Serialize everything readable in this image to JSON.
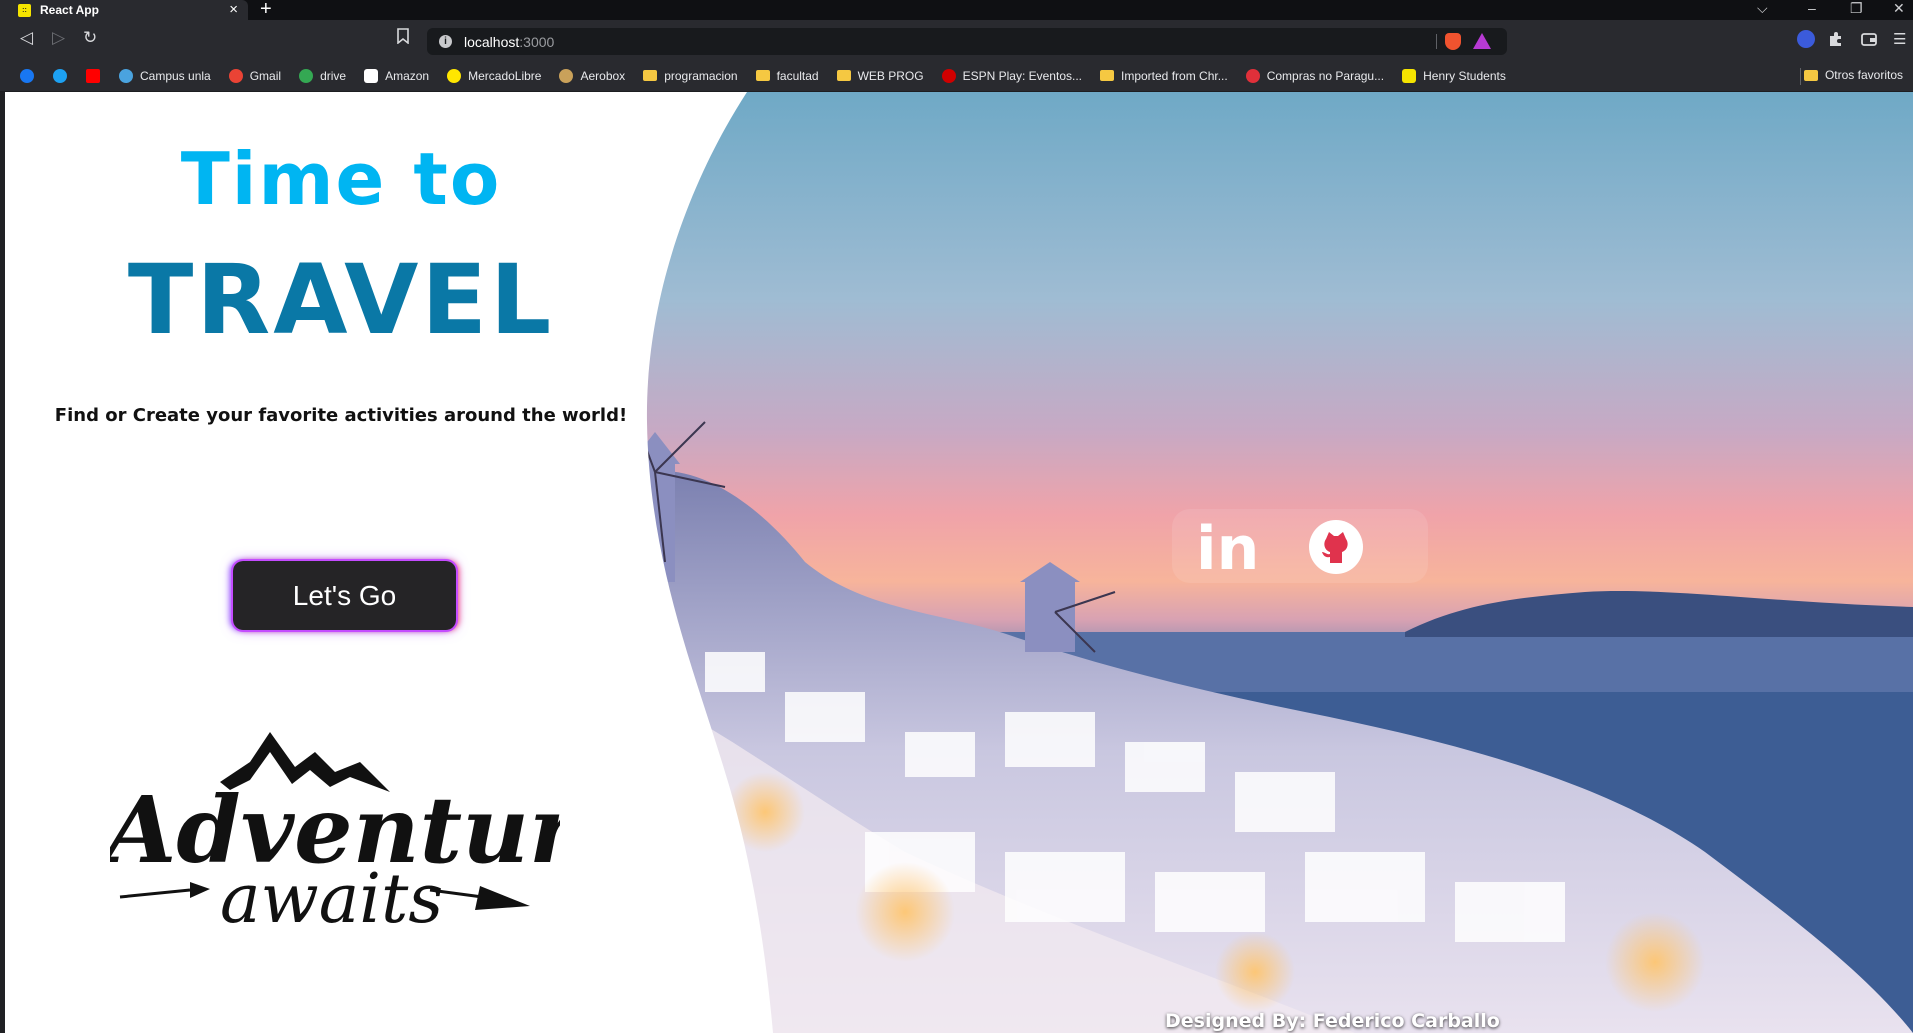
{
  "browser": {
    "tab_title": "React App",
    "tab_favicon_text": "::",
    "tab_close": "×",
    "new_tab": "+",
    "url_host": "localhost",
    "url_port": ":3000",
    "window_controls": {
      "dropdown": "⌵",
      "minimize": "–",
      "restore": "❐",
      "close": "✕"
    },
    "nav": {
      "back": "◁",
      "forward": "▷",
      "reload": "↻",
      "bookmark": "🔖︎"
    },
    "menu": "☰"
  },
  "bookmarks": [
    {
      "label": "",
      "icon": "facebook-icon",
      "color": "#1877f2"
    },
    {
      "label": "",
      "icon": "twitter-icon",
      "color": "#1da1f2"
    },
    {
      "label": "",
      "icon": "youtube-icon",
      "color": "#ff0000"
    },
    {
      "label": "Campus unla",
      "icon": "campus-icon",
      "color": "#4aa3df"
    },
    {
      "label": "Gmail",
      "icon": "gmail-icon",
      "color": "#ea4335"
    },
    {
      "label": "drive",
      "icon": "drive-icon",
      "color": "#34a853"
    },
    {
      "label": "Amazon",
      "icon": "amazon-icon",
      "color": "#ffffff"
    },
    {
      "label": "MercadoLibre",
      "icon": "mercadolibre-icon",
      "color": "#ffe600"
    },
    {
      "label": "Aerobox",
      "icon": "aerobox-icon",
      "color": "#c9a15a"
    },
    {
      "label": "programacion",
      "icon": "folder-icon",
      "color": "#f5c842"
    },
    {
      "label": "facultad",
      "icon": "folder-icon",
      "color": "#f5c842"
    },
    {
      "label": "WEB PROG",
      "icon": "folder-icon",
      "color": "#f5c842"
    },
    {
      "label": "ESPN Play: Eventos...",
      "icon": "espn-icon",
      "color": "#d00000"
    },
    {
      "label": "Imported from Chr...",
      "icon": "folder-icon",
      "color": "#f5c842"
    },
    {
      "label": "Compras no Paragu...",
      "icon": "compras-icon",
      "color": "#e0303a"
    },
    {
      "label": "Henry Students",
      "icon": "henry-icon",
      "color": "#f5e400"
    }
  ],
  "bookmarks_other": "Otros favoritos",
  "landing": {
    "title_line1": "Time to",
    "title_line2": "TRAVEL",
    "subtitle": "Find or Create your favorite activities around the world!",
    "cta_label": "Let's Go",
    "logo_text_line1": "Adventure",
    "logo_text_line2": "awaits",
    "credit": "Designed By: Federico Carballo",
    "linkedin_text": "in",
    "colors": {
      "time": "#00b5f2",
      "travel": "#0a78a6",
      "button_bg": "#252426"
    }
  }
}
